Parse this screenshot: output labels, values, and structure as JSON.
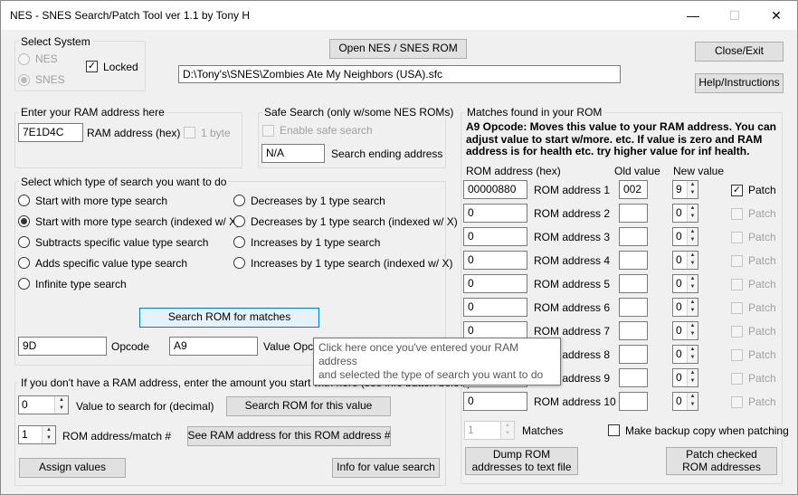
{
  "window": {
    "title": "NES - SNES Search/Patch Tool ver 1.1 by Tony H",
    "minimize": "—",
    "maximize": "☐",
    "close": "✕"
  },
  "system": {
    "label": "Select System",
    "nes": "NES",
    "snes": "SNES",
    "locked": "Locked"
  },
  "top": {
    "open_rom": "Open NES / SNES ROM",
    "rom_path": "D:\\Tony's\\SNES\\Zombies Ate My Neighbors (USA).sfc",
    "close_exit": "Close/Exit",
    "help": "Help/Instructions"
  },
  "ram": {
    "label": "Enter your RAM address here",
    "value": "7E1D4C",
    "hex_label": "RAM address (hex)",
    "one_byte": "1 byte"
  },
  "safe": {
    "label": "Safe Search (only w/some NES ROMs)",
    "enable": "Enable safe search",
    "ending_value": "N/A",
    "ending_label": "Search ending address"
  },
  "search_type": {
    "label": "Select which type of search you want to do",
    "left": [
      "Start with more type search",
      "Start with more type search (indexed w/ X)",
      "Subtracts specific value type search",
      "Adds specific value type search",
      "Infinite type search"
    ],
    "right": [
      "Decreases by 1 type search",
      "Decreases by 1 type search (indexed w/ X)",
      "Increases by 1 type search",
      "Increases by 1 type search (indexed w/ X)"
    ],
    "search_button": "Search ROM for matches",
    "opcode_value": "9D",
    "opcode_label": "Opcode",
    "value_opcode_value": "A9",
    "value_opcode_label": "Value Opco"
  },
  "tooltip": {
    "line1": "Click here once you've entered your RAM address",
    "line2": "and selected the type of search you want to do"
  },
  "noram": {
    "label": "If you don't have a RAM address, enter the amount you start with here (see info button below)",
    "value": "0",
    "value_label": "Value to search for (decimal)",
    "search_value_button": "Search ROM for this value",
    "match_num": "1",
    "match_label": "ROM address/match #",
    "see_ram_button": "See RAM address for this ROM address #",
    "assign_button": "Assign values",
    "info_button": "Info for value search"
  },
  "matches": {
    "label": "Matches found in your ROM",
    "description": "A9 Opcode: Moves this value to your RAM address. You can adjust value to start w/more. etc. If value is zero and RAM address is for health etc. try higher value for inf health.",
    "col_rom": "ROM address (hex)",
    "col_old": "Old value",
    "col_new": "New value",
    "patch_label": "Patch",
    "rows": [
      {
        "rom": "00000880",
        "label": "ROM address 1",
        "old": "002",
        "new": "9",
        "checked": true
      },
      {
        "rom": "0",
        "label": "ROM address 2",
        "old": "",
        "new": "0",
        "checked": false
      },
      {
        "rom": "0",
        "label": "ROM address 3",
        "old": "",
        "new": "0",
        "checked": false
      },
      {
        "rom": "0",
        "label": "ROM address 4",
        "old": "",
        "new": "0",
        "checked": false
      },
      {
        "rom": "0",
        "label": "ROM address 5",
        "old": "",
        "new": "0",
        "checked": false
      },
      {
        "rom": "0",
        "label": "ROM address 6",
        "old": "",
        "new": "0",
        "checked": false
      },
      {
        "rom": "0",
        "label": "ROM address 7",
        "old": "",
        "new": "0",
        "checked": false
      },
      {
        "rom": "0",
        "label": "ROM address 8",
        "old": "",
        "new": "0",
        "checked": false
      },
      {
        "rom": "0",
        "label": "ROM address 9",
        "old": "",
        "new": "0",
        "checked": false
      },
      {
        "rom": "0",
        "label": "ROM address 10",
        "old": "",
        "new": "0",
        "checked": false
      }
    ],
    "match_count": "1",
    "matches_label": "Matches",
    "backup_label": "Make backup copy when patching",
    "dump_button": "Dump ROM addresses to text file",
    "patch_button": "Patch checked ROM addresses"
  }
}
